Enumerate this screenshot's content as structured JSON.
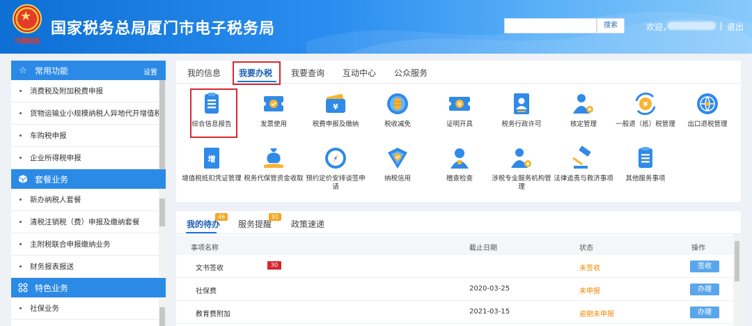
{
  "header": {
    "emblem_text": "中國稅務",
    "title": "国家税务总局厦门市电子税务局",
    "search_value": "",
    "search_button": "搜索",
    "welcome": "欢迎，",
    "logout": "退出"
  },
  "sidebar": {
    "sections": [
      {
        "title": "常用功能",
        "icon": "star-icon",
        "setting": "设置",
        "items": [
          "消费税及附加税费申报",
          "货物运输业小规模纳税人异地代开增值税专用...",
          "车购税申报",
          "企业所得税申报"
        ]
      },
      {
        "title": "套餐业务",
        "icon": "cube-icon",
        "items": [
          "新办纳税人套餐",
          "清税注销税（费）申报及缴纳套餐",
          "主附税联合申报缴纳业务",
          "财务报表报送"
        ]
      },
      {
        "title": "特色业务",
        "icon": "grid-icon",
        "items": [
          "社保业务"
        ]
      }
    ]
  },
  "main": {
    "tabs": [
      "我的信息",
      "我要办税",
      "我要查询",
      "互动中心",
      "公众服务"
    ],
    "active_tab": "我要办税",
    "icons_row1": [
      {
        "label": "综合信息报告",
        "icon": "clipboard-icon"
      },
      {
        "label": "发票使用",
        "icon": "invoice-icon"
      },
      {
        "label": "税费申报及缴纳",
        "icon": "wallet-icon"
      },
      {
        "label": "税收减免",
        "icon": "coin-stack-icon"
      },
      {
        "label": "证明开具",
        "icon": "ticket-icon"
      },
      {
        "label": "税务行政许可",
        "icon": "id-card-icon"
      },
      {
        "label": "核定管理",
        "icon": "user-gear-icon"
      },
      {
        "label": "一般退（抵）税管理",
        "icon": "refund-icon"
      },
      {
        "label": "出口退税管理",
        "icon": "globe-icon"
      }
    ],
    "icons_row2": [
      {
        "label": "增值税抵扣凭证管理",
        "icon": "vat-receipt-icon"
      },
      {
        "label": "税务代保管资金收取",
        "icon": "money-bag-icon"
      },
      {
        "label": "预约定价安排谈签申请",
        "icon": "compass-icon"
      },
      {
        "label": "纳税信用",
        "icon": "shield-check-icon"
      },
      {
        "label": "稽查检查",
        "icon": "inspector-icon"
      },
      {
        "label": "涉税专业服务机构管理",
        "icon": "agency-icon"
      },
      {
        "label": "法律追责与救济事项",
        "icon": "gavel-icon"
      },
      {
        "label": "其他服务事项",
        "icon": "list-icon"
      }
    ]
  },
  "todo": {
    "tabs": [
      {
        "label": "我的待办",
        "badge": "46"
      },
      {
        "label": "服务提醒",
        "badge": "91"
      },
      {
        "label": "政策速递",
        "badge": ""
      }
    ],
    "columns": [
      "事项名称",
      "截止日期",
      "状态",
      "操作"
    ],
    "rows": [
      {
        "name": "文书签收",
        "badge": "30",
        "date": "",
        "status": "未签收",
        "action": "签收"
      },
      {
        "name": "社保费",
        "badge": "",
        "date": "2020-03-25",
        "status": "未申报",
        "action": "办理"
      },
      {
        "name": "教育费附加",
        "badge": "",
        "date": "2021-03-15",
        "status": "逾期未申报",
        "action": "办理"
      }
    ]
  },
  "colors": {
    "header_blue": "#1a7ae0",
    "accent_blue": "#2b8ae6",
    "highlight_red": "#d7262e",
    "status_orange": "#f08a00"
  }
}
